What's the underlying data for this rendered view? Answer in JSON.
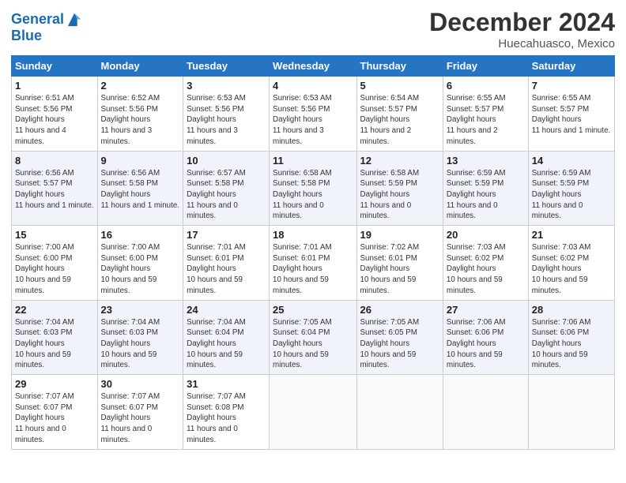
{
  "logo": {
    "line1": "General",
    "line2": "Blue"
  },
  "title": "December 2024",
  "subtitle": "Huecahuasco, Mexico",
  "weekdays": [
    "Sunday",
    "Monday",
    "Tuesday",
    "Wednesday",
    "Thursday",
    "Friday",
    "Saturday"
  ],
  "weeks": [
    [
      {
        "day": "1",
        "sunrise": "6:51 AM",
        "sunset": "5:56 PM",
        "daylight": "11 hours and 4 minutes."
      },
      {
        "day": "2",
        "sunrise": "6:52 AM",
        "sunset": "5:56 PM",
        "daylight": "11 hours and 3 minutes."
      },
      {
        "day": "3",
        "sunrise": "6:53 AM",
        "sunset": "5:56 PM",
        "daylight": "11 hours and 3 minutes."
      },
      {
        "day": "4",
        "sunrise": "6:53 AM",
        "sunset": "5:56 PM",
        "daylight": "11 hours and 3 minutes."
      },
      {
        "day": "5",
        "sunrise": "6:54 AM",
        "sunset": "5:57 PM",
        "daylight": "11 hours and 2 minutes."
      },
      {
        "day": "6",
        "sunrise": "6:55 AM",
        "sunset": "5:57 PM",
        "daylight": "11 hours and 2 minutes."
      },
      {
        "day": "7",
        "sunrise": "6:55 AM",
        "sunset": "5:57 PM",
        "daylight": "11 hours and 1 minute."
      }
    ],
    [
      {
        "day": "8",
        "sunrise": "6:56 AM",
        "sunset": "5:57 PM",
        "daylight": "11 hours and 1 minute."
      },
      {
        "day": "9",
        "sunrise": "6:56 AM",
        "sunset": "5:58 PM",
        "daylight": "11 hours and 1 minute."
      },
      {
        "day": "10",
        "sunrise": "6:57 AM",
        "sunset": "5:58 PM",
        "daylight": "11 hours and 0 minutes."
      },
      {
        "day": "11",
        "sunrise": "6:58 AM",
        "sunset": "5:58 PM",
        "daylight": "11 hours and 0 minutes."
      },
      {
        "day": "12",
        "sunrise": "6:58 AM",
        "sunset": "5:59 PM",
        "daylight": "11 hours and 0 minutes."
      },
      {
        "day": "13",
        "sunrise": "6:59 AM",
        "sunset": "5:59 PM",
        "daylight": "11 hours and 0 minutes."
      },
      {
        "day": "14",
        "sunrise": "6:59 AM",
        "sunset": "5:59 PM",
        "daylight": "11 hours and 0 minutes."
      }
    ],
    [
      {
        "day": "15",
        "sunrise": "7:00 AM",
        "sunset": "6:00 PM",
        "daylight": "10 hours and 59 minutes."
      },
      {
        "day": "16",
        "sunrise": "7:00 AM",
        "sunset": "6:00 PM",
        "daylight": "10 hours and 59 minutes."
      },
      {
        "day": "17",
        "sunrise": "7:01 AM",
        "sunset": "6:01 PM",
        "daylight": "10 hours and 59 minutes."
      },
      {
        "day": "18",
        "sunrise": "7:01 AM",
        "sunset": "6:01 PM",
        "daylight": "10 hours and 59 minutes."
      },
      {
        "day": "19",
        "sunrise": "7:02 AM",
        "sunset": "6:01 PM",
        "daylight": "10 hours and 59 minutes."
      },
      {
        "day": "20",
        "sunrise": "7:03 AM",
        "sunset": "6:02 PM",
        "daylight": "10 hours and 59 minutes."
      },
      {
        "day": "21",
        "sunrise": "7:03 AM",
        "sunset": "6:02 PM",
        "daylight": "10 hours and 59 minutes."
      }
    ],
    [
      {
        "day": "22",
        "sunrise": "7:04 AM",
        "sunset": "6:03 PM",
        "daylight": "10 hours and 59 minutes."
      },
      {
        "day": "23",
        "sunrise": "7:04 AM",
        "sunset": "6:03 PM",
        "daylight": "10 hours and 59 minutes."
      },
      {
        "day": "24",
        "sunrise": "7:04 AM",
        "sunset": "6:04 PM",
        "daylight": "10 hours and 59 minutes."
      },
      {
        "day": "25",
        "sunrise": "7:05 AM",
        "sunset": "6:04 PM",
        "daylight": "10 hours and 59 minutes."
      },
      {
        "day": "26",
        "sunrise": "7:05 AM",
        "sunset": "6:05 PM",
        "daylight": "10 hours and 59 minutes."
      },
      {
        "day": "27",
        "sunrise": "7:06 AM",
        "sunset": "6:06 PM",
        "daylight": "10 hours and 59 minutes."
      },
      {
        "day": "28",
        "sunrise": "7:06 AM",
        "sunset": "6:06 PM",
        "daylight": "10 hours and 59 minutes."
      }
    ],
    [
      {
        "day": "29",
        "sunrise": "7:07 AM",
        "sunset": "6:07 PM",
        "daylight": "11 hours and 0 minutes."
      },
      {
        "day": "30",
        "sunrise": "7:07 AM",
        "sunset": "6:07 PM",
        "daylight": "11 hours and 0 minutes."
      },
      {
        "day": "31",
        "sunrise": "7:07 AM",
        "sunset": "6:08 PM",
        "daylight": "11 hours and 0 minutes."
      },
      null,
      null,
      null,
      null
    ]
  ]
}
